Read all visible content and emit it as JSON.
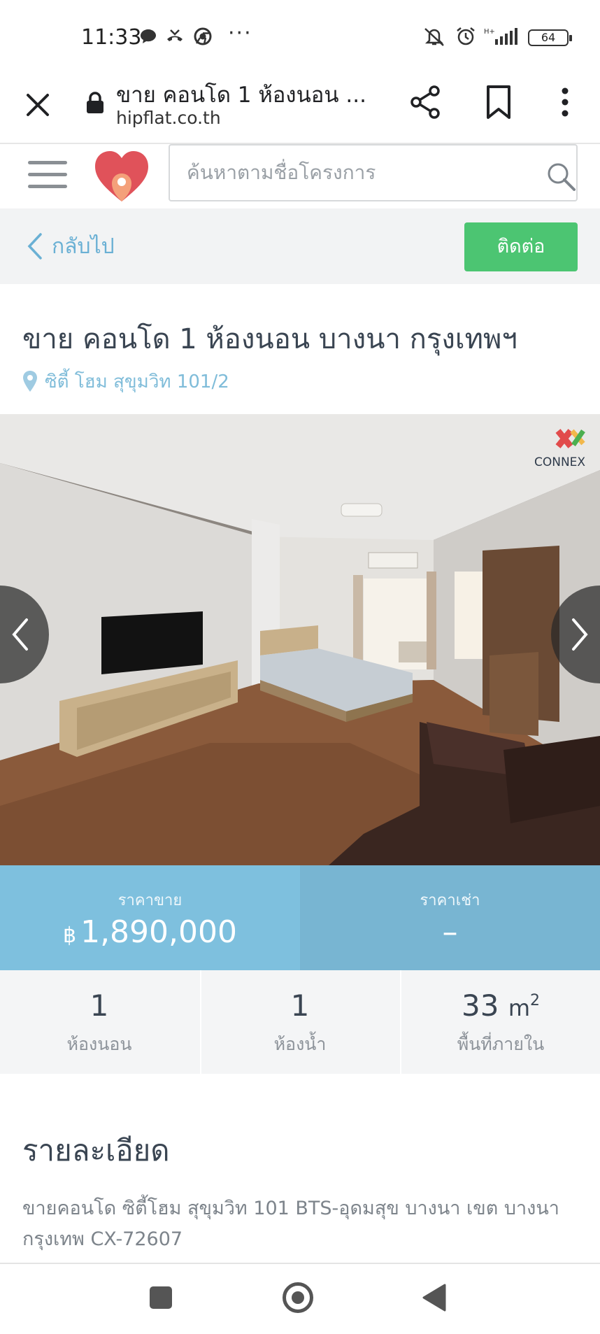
{
  "status_bar": {
    "time": "11:33",
    "battery": "64",
    "icons": [
      "chat-bubble-icon",
      "missed-call-icon",
      "chrome-icon",
      "more-dots-icon",
      "vibrate-off-icon",
      "alarm-icon",
      "hplus-signal-icon",
      "battery-icon"
    ]
  },
  "browser": {
    "page_title": "ขาย คอนโด 1 ห้องนอน ...",
    "domain": "hipflat.co.th"
  },
  "site_header": {
    "search_placeholder": "ค้นหาตามชื่อโครงการ"
  },
  "back_bar": {
    "back_label": "กลับไป",
    "contact_label": "ติดต่อ"
  },
  "listing": {
    "title": "ขาย คอนโด 1 ห้องนอน บางนา กรุงเทพฯ",
    "location": "ซิตี้ โฮม สุขุมวิท 101/2"
  },
  "price": {
    "sale_label": "ราคาขาย",
    "currency": "฿",
    "sale_value": "1,890,000",
    "rent_label": "ราคาเช่า",
    "rent_value": "–"
  },
  "stats": [
    {
      "value": "1",
      "unit": "",
      "label": "ห้องนอน"
    },
    {
      "value": "1",
      "unit": "",
      "label": "ห้องน้ำ"
    },
    {
      "value": "33",
      "unit": "m",
      "unit_sup": "2",
      "label": "พื้นที่ภายใน"
    }
  ],
  "details": {
    "heading": "รายละเอียด",
    "text": "ขายคอนโด ซิตี้โฮม สุขุมวิท 101 BTS-อุดมสุข บางนา เขต บางนา กรุงเทพ CX-72607"
  },
  "watermark": {
    "text": "CONNEX"
  },
  "colors": {
    "accent_blue": "#7ec0de",
    "contact_green": "#4cc572",
    "title_text": "#3a4552",
    "link_blue": "#6ab0d4"
  }
}
